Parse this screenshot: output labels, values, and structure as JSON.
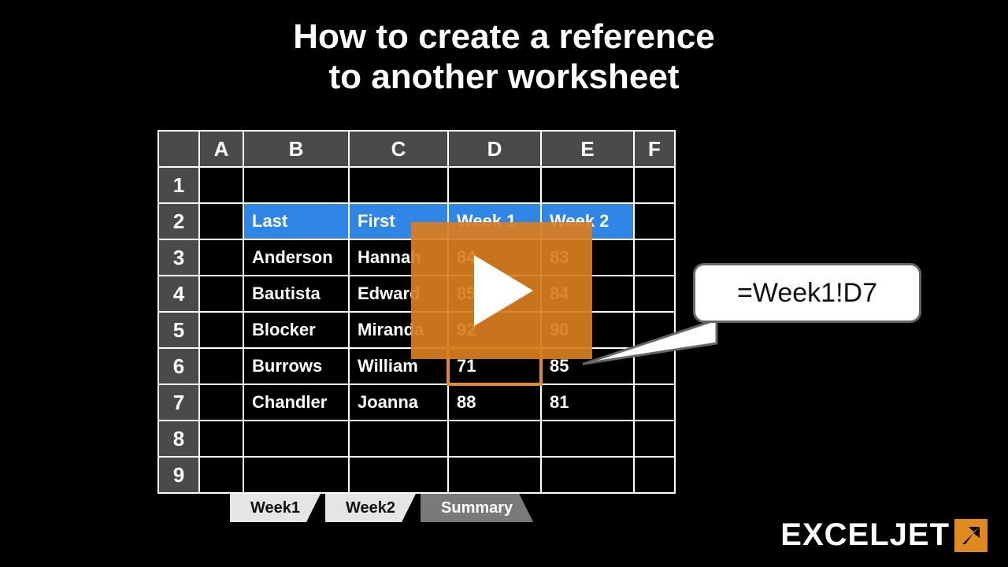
{
  "title_line1": "How to create a reference",
  "title_line2": "to another worksheet",
  "columns": [
    "A",
    "B",
    "C",
    "D",
    "E",
    "F"
  ],
  "rows": [
    "1",
    "2",
    "3",
    "4",
    "5",
    "6",
    "7",
    "8",
    "9"
  ],
  "headers": {
    "last": "Last",
    "first": "First",
    "week1": "Week 1",
    "week2": "Week 2"
  },
  "data": {
    "r3": {
      "last": "Anderson",
      "first": "Hannah",
      "w1": "84",
      "w2": "83"
    },
    "r4": {
      "last": "Bautista",
      "first": "Edward",
      "w1": "85",
      "w2": "84"
    },
    "r5": {
      "last": "Blocker",
      "first": "Miranda",
      "w1": "92",
      "w2": "90"
    },
    "r6": {
      "last": "Burrows",
      "first": "William",
      "w1": "71",
      "w2": "85"
    },
    "r7": {
      "last": "Chandler",
      "first": "Joanna",
      "w1": "88",
      "w2": "81"
    }
  },
  "selected_cell": "D6",
  "formula": "=Week1!D7",
  "tabs": {
    "t1": "Week1",
    "t2": "Week2",
    "t3": "Summary"
  },
  "active_tab": "Summary",
  "brand": "EXCELJET"
}
